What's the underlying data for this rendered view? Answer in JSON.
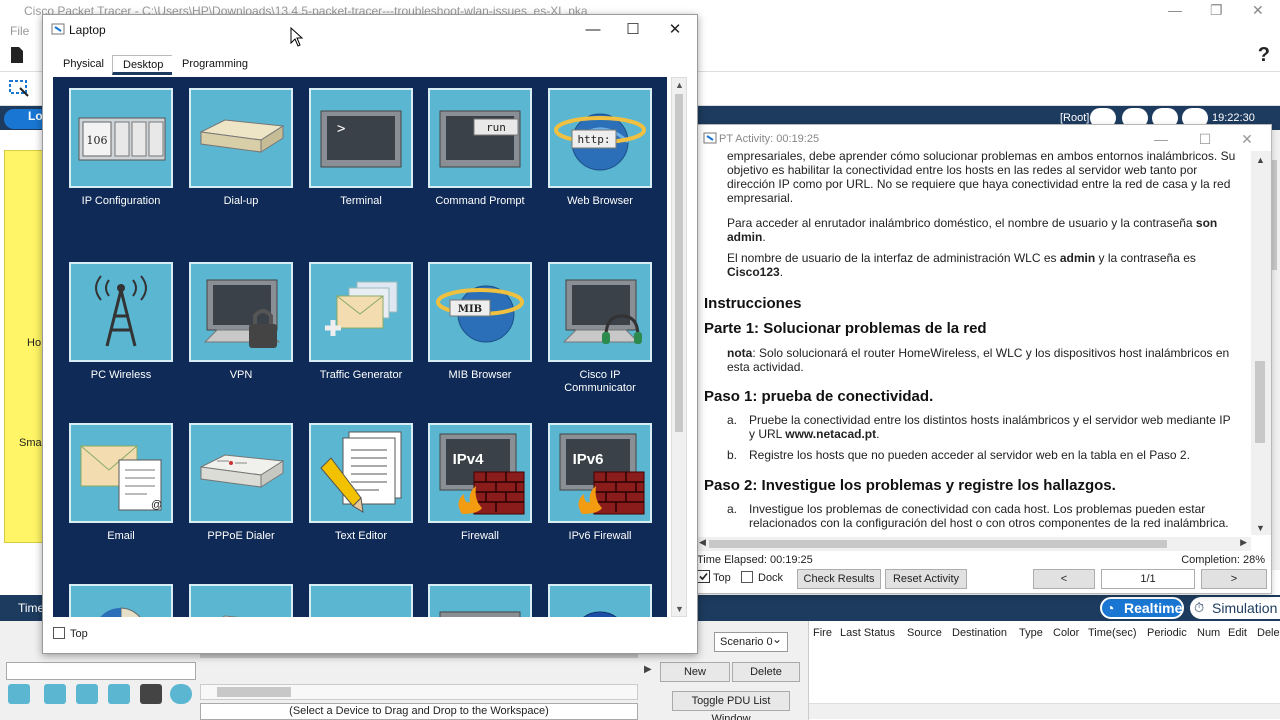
{
  "main_window": {
    "title": "Cisco Packet Tracer - C:\\Users\\HP\\Downloads\\13.4.5-packet-tracer---troubleshoot-wlan-issues_es-XL.pka",
    "menu_file": "File",
    "help_icon": "?",
    "logical_label": "Lo",
    "root_label": "[Root]",
    "clock": "19:22:30",
    "workspace_label_1": "Ho",
    "workspace_label_2": "Smar",
    "time_label": "Time",
    "realtime": "Realtime",
    "simulation": "Simulation",
    "device_hint": "(Select a Device to Drag and Drop to the Workspace)",
    "scenario": "Scenario 0",
    "new_button": "New",
    "delete_button": "Delete",
    "toggle_pdu": "Toggle PDU List Window",
    "pdu_columns": [
      "Fire",
      "Last Status",
      "Source",
      "Destination",
      "Type",
      "Color",
      "Time(sec)",
      "Periodic",
      "Num",
      "Edit",
      "Dele"
    ]
  },
  "laptop": {
    "title": "Laptop",
    "tabs": [
      "Physical",
      "Desktop",
      "Programming"
    ],
    "active_tab": "Desktop",
    "apps": [
      {
        "label": "IP Configuration",
        "icon": "ip-config-icon",
        "glyph": "106"
      },
      {
        "label": "Dial-up",
        "icon": "modem-icon"
      },
      {
        "label": "Terminal",
        "icon": "terminal-icon",
        "glyph": ">"
      },
      {
        "label": "Command Prompt",
        "icon": "command-prompt-icon",
        "glyph": "run"
      },
      {
        "label": "Web Browser",
        "icon": "web-browser-icon",
        "glyph": "http:"
      },
      {
        "label": "PC Wireless",
        "icon": "wireless-tower-icon"
      },
      {
        "label": "VPN",
        "icon": "vpn-lock-icon"
      },
      {
        "label": "Traffic Generator",
        "icon": "traffic-generator-icon"
      },
      {
        "label": "MIB Browser",
        "icon": "mib-browser-icon",
        "glyph": "MIB"
      },
      {
        "label": "Cisco IP Communicator",
        "icon": "ip-communicator-icon"
      },
      {
        "label": "Email",
        "icon": "email-icon",
        "glyph": "@"
      },
      {
        "label": "PPPoE Dialer",
        "icon": "pppoe-dialer-icon"
      },
      {
        "label": "Text Editor",
        "icon": "text-editor-icon"
      },
      {
        "label": "Firewall",
        "icon": "firewall-icon",
        "glyph": "IPv4"
      },
      {
        "label": "IPv6 Firewall",
        "icon": "ipv6-firewall-icon",
        "glyph": "IPv6"
      }
    ],
    "top_checkbox": "Top"
  },
  "activity": {
    "title": "PT Activity: 00:19:25",
    "para1": "empresariales, debe aprender cómo solucionar problemas en ambos entornos inalámbricos. Su objetivo es habilitar la conectividad entre los hosts en las redes al servidor web tanto por dirección IP como por URL. No se requiere que haya conectividad entre la red de casa y la red empresarial.",
    "para2_pre": "Para acceder al enrutador inalámbrico doméstico, el nombre de usuario y la contraseña ",
    "para2_bold": "son admin",
    "para2_post": ".",
    "para3_pre": "El nombre de usuario de la interfaz de administración WLC es ",
    "para3_bold1": "admin",
    "para3_mid": " y la contraseña es ",
    "para3_bold2": "Cisco123",
    "para3_post": ".",
    "instructions": "Instrucciones",
    "part1": "Parte 1: Solucionar problemas de la red",
    "note_bold": "nota",
    "note_text": ": Solo solucionará el router HomeWireless, el WLC y los dispositivos host inalámbricos en esta actividad.",
    "step1": "Paso 1: prueba de conectividad.",
    "step1_a_label": "a.",
    "step1_a_pre": "Pruebe la conectividad entre los distintos hosts inalámbricos y el servidor web mediante IP y URL ",
    "step1_a_bold": "www.netacad.pt",
    "step1_a_post": ".",
    "step1_b_label": "b.",
    "step1_b": "Registre los hosts que no pueden acceder al servidor web en la tabla en el Paso 2.",
    "step2": "Paso 2: Investigue los problemas y registre los hallazgos.",
    "step2_a_label": "a.",
    "step2_a": "Investigue los problemas de conectividad con cada host. Los problemas pueden estar relacionados con la configuración del host o con otros componentes de la red inalámbrica.",
    "time_elapsed": "Time Elapsed: 00:19:25",
    "completion": "Completion: 28%",
    "top_label": "Top",
    "dock_label": "Dock",
    "check_results": "Check Results",
    "reset_activity": "Reset Activity",
    "prev": "<",
    "page": "1/1",
    "next": ">"
  }
}
